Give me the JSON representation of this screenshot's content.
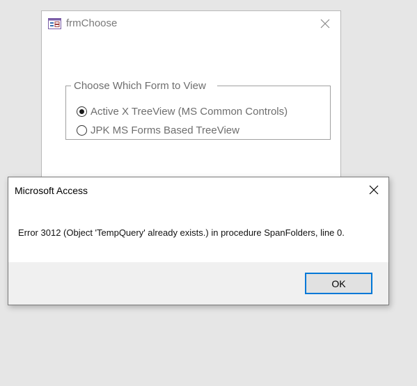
{
  "form": {
    "title": "frmChoose",
    "group_title": "Choose Which Form to View",
    "options": [
      {
        "label": "Active X TreeView (MS Common Controls)",
        "selected": true
      },
      {
        "label": "JPK MS Forms Based TreeView",
        "selected": false
      }
    ],
    "icons": {
      "app": "form-icon",
      "close": "close-icon"
    }
  },
  "dialog": {
    "title": "Microsoft Access",
    "message": "Error 3012 (Object 'TempQuery' already exists.) in procedure SpanFolders, line 0.",
    "ok_label": "OK",
    "accent_color": "#0078d7"
  }
}
